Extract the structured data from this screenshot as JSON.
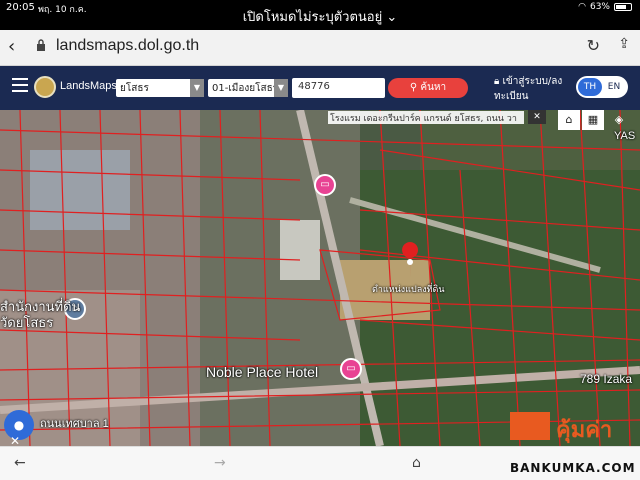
{
  "status": {
    "time": "20:05",
    "date": "พฤ. 10 ก.ค.",
    "mode_text": "เปิดโหมดไม่ระบุตัวตนอยู่",
    "battery": "63%"
  },
  "browser": {
    "url": "landsmaps.dol.go.th"
  },
  "nav": {
    "brand": "LandsMaps",
    "province": "ยโสธร",
    "district": "01-เมืองยโสธร",
    "parcel_number": "48776",
    "search_label": "ค้นหา",
    "login_label": "เข้าสู่ระบบ/ลงทะเบียน",
    "lang_th": "TH",
    "lang_en": "EN"
  },
  "map": {
    "info_text": "โรงแรม เดอะกรีนปาร์ค แกรนด์ ยโสธร, ถนน วา",
    "label_noble": "Noble Place Hotel",
    "label_izaka": "789 Izaka",
    "label_land_office": "สำนักงานที่ดิน",
    "label_land_office2": "วัดยโสธร",
    "label_pin": "ตำแหน่งแปลงที่ดิน",
    "label_road": "ถนนเทศบาล 1",
    "label_asa": "YAS"
  },
  "watermark": {
    "text": "คุ้มค่า",
    "site": "BANKUMKA.COM"
  },
  "colors": {
    "nav_bg": "#1b2a52",
    "search_btn": "#e8413d",
    "parcel_lines": "#e02020",
    "pin": "#e02020",
    "hotel_pin": "#e84393"
  }
}
